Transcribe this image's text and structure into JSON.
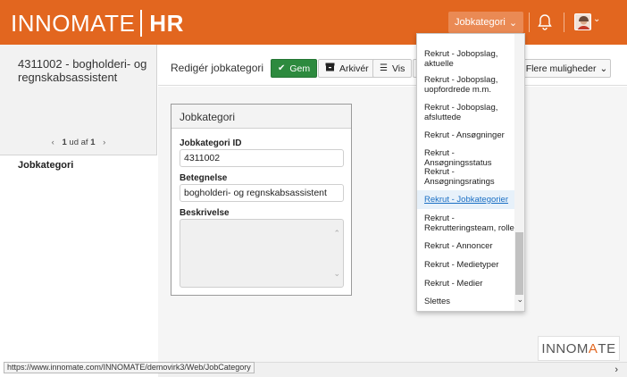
{
  "header": {
    "brand_left": "INNOMATE",
    "brand_right": "HR",
    "dropdown_label": "Jobkategori",
    "dropdown_icon": "chevron-down-icon",
    "bell_icon": "bell-icon",
    "avatar_icon": "user-avatar"
  },
  "left_panel": {
    "record_title": "4311002 - bogholderi- og regnskabsassistent",
    "pager_current": "1",
    "pager_mid": "ud af",
    "pager_total": "1",
    "nav_item": "Jobkategori"
  },
  "toolbar": {
    "page_title": "Redigér jobkategori",
    "save_label": "Gem",
    "archive_label": "Arkivér",
    "view_label": "Vis",
    "more_label": "Flere muligheder"
  },
  "form": {
    "card_title": "Jobkategori",
    "id_label": "Jobkategori ID",
    "id_value": "4311002",
    "name_label": "Betegnelse",
    "name_value": "bogholderi- og regnskabsassistent",
    "desc_label": "Beskrivelse",
    "desc_value": ""
  },
  "menu": {
    "items": [
      "Rekrut - Jobopslag, aktuelle",
      "Rekrut - Jobopslag, uopfordrede m.m.",
      "Rekrut - Jobopslag, afsluttede",
      "Rekrut - Ansøgninger",
      "Rekrut - Ansøgningsstatus",
      "Rekrut - Ansøgningsratings",
      "Rekrut - Jobkategorier",
      "Rekrut - Rekrutteringsteam, rolle",
      "Rekrut - Annoncer",
      "Rekrut - Medietyper",
      "Rekrut - Medier",
      "Slettes"
    ],
    "active_item": "Rekrut - Jobkategorier"
  },
  "status": {
    "url": "https://www.innomate.com/INNOMATE/demovirk3/Web/JobCategory"
  },
  "footer_logo": {
    "part1": "INNOM",
    "part2": "A",
    "part3": "TE"
  },
  "colors": {
    "brand_orange": "#e2661f",
    "save_green": "#2d8a3e",
    "link_blue": "#1a6fc4"
  }
}
